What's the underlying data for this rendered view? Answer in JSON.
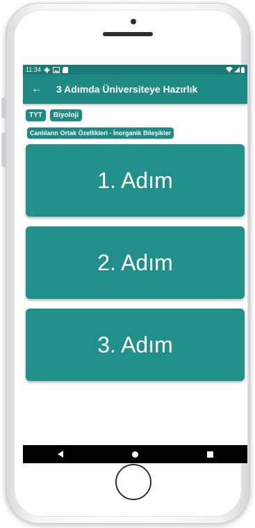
{
  "status_bar": {
    "time": "11:34",
    "icons": [
      "gear-icon",
      "image-icon",
      "sd-card-icon"
    ],
    "right_icons": [
      "wifi-icon",
      "signal-icon",
      "battery-icon"
    ]
  },
  "app_bar": {
    "title": "3 Adımda Üniversiteye Hazırlık",
    "back_glyph": "←"
  },
  "chips": [
    {
      "label": "TYT"
    },
    {
      "label": "Biyoloji"
    }
  ],
  "topic": {
    "label": "Canlıların Ortak Özellikleri - İnorganik Bileşikler"
  },
  "steps": [
    {
      "label": "1. Adım"
    },
    {
      "label": "2. Adım"
    },
    {
      "label": "3. Adım"
    }
  ],
  "colors": {
    "primary": "#1f8a84",
    "primary_dark": "#1a7a74",
    "step": "#21908a"
  }
}
